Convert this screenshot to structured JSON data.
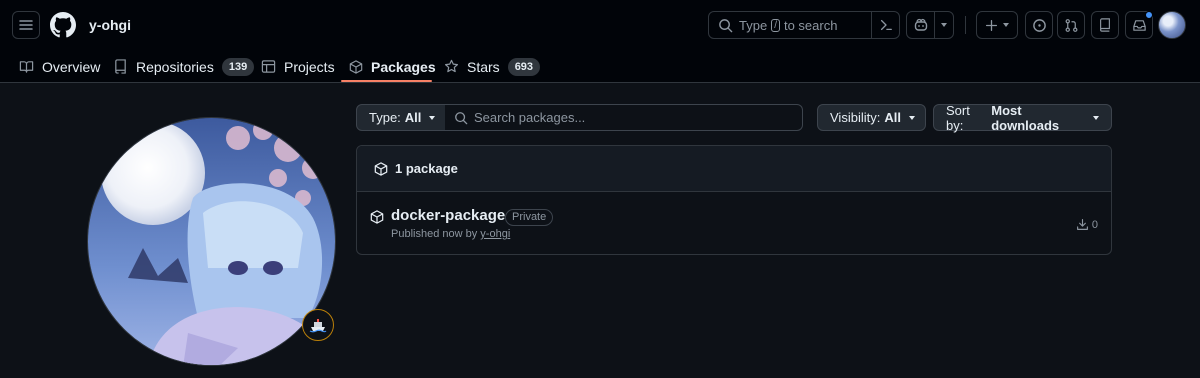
{
  "header": {
    "owner": "y-ohgi",
    "search": {
      "prefix": "Type",
      "key": "/",
      "suffix": "to search"
    }
  },
  "nav": {
    "tabs": [
      {
        "label": "Overview",
        "icon": "book-icon"
      },
      {
        "label": "Repositories",
        "icon": "repo-icon",
        "count": "139"
      },
      {
        "label": "Projects",
        "icon": "table-icon"
      },
      {
        "label": "Packages",
        "icon": "package-icon",
        "active": true
      },
      {
        "label": "Stars",
        "icon": "star-icon",
        "count": "693"
      }
    ]
  },
  "filters": {
    "type_label": "Type:",
    "type_value": "All",
    "search_placeholder": "Search packages...",
    "visibility_label": "Visibility:",
    "visibility_value": "All",
    "sort_label": "Sort by:",
    "sort_value": "Most downloads"
  },
  "packages": {
    "count_label": "1 package",
    "items": [
      {
        "name": "docker-package",
        "visibility": "Private",
        "published_text": "Published now by",
        "publisher": "y-ohgi",
        "downloads": "0"
      }
    ]
  },
  "colors": {
    "accent_underline": "#f78166",
    "notification": "#4493f8",
    "background": "#0d1117",
    "header_bg": "#010409"
  },
  "status_emoji": "ship-icon"
}
